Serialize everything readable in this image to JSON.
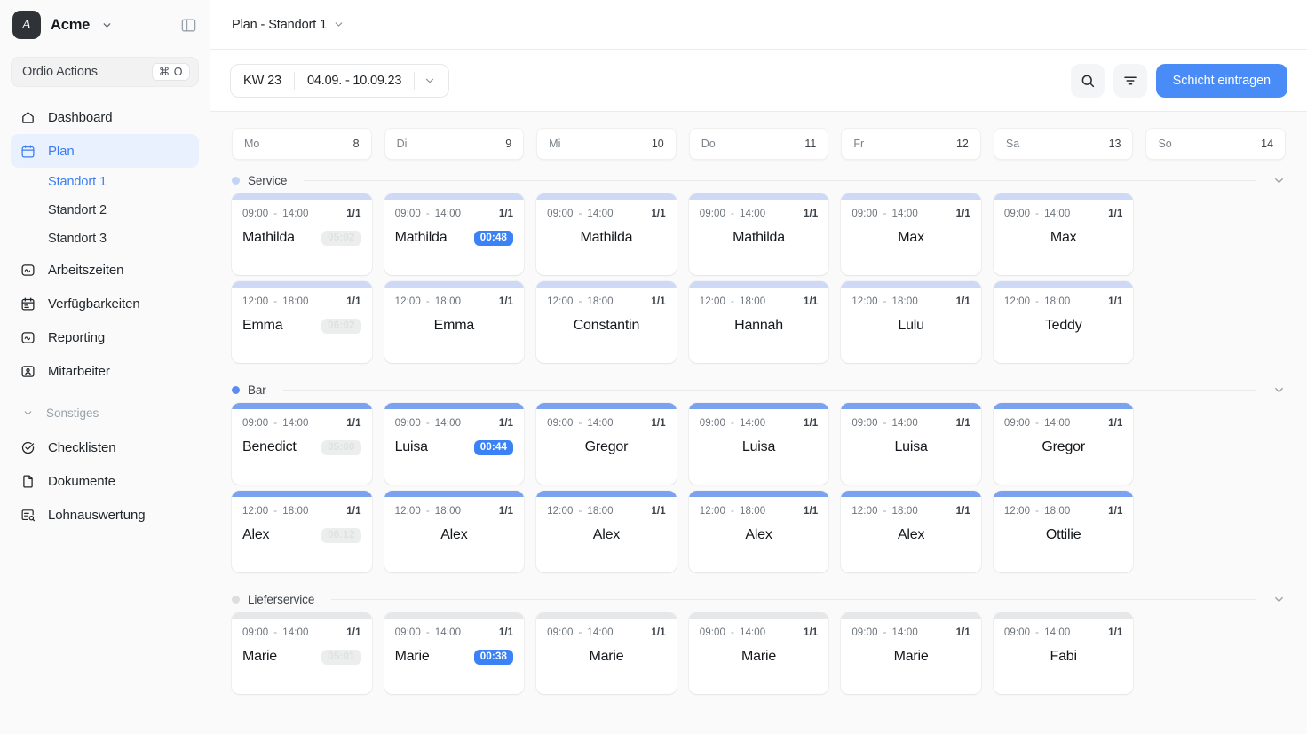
{
  "sidebar": {
    "brand": {
      "logo_letter": "A",
      "name": "Acme",
      "caret_icon": "chevron-down-icon",
      "panel_toggle_icon": "panel-toggle-icon"
    },
    "actions": {
      "label": "Ordio Actions",
      "shortcut": "⌘ O"
    },
    "items": [
      {
        "label": "Dashboard",
        "icon": "home-icon",
        "active": false
      },
      {
        "label": "Plan",
        "icon": "calendar-icon",
        "active": true
      },
      {
        "label": "Arbeitszeiten",
        "icon": "clock-wave-icon",
        "active": false
      },
      {
        "label": "Verfügbarkeiten",
        "icon": "calendar-check-icon",
        "active": false
      },
      {
        "label": "Reporting",
        "icon": "chart-wave-icon",
        "active": false
      },
      {
        "label": "Mitarbeiter",
        "icon": "user-card-icon",
        "active": false
      }
    ],
    "sub_items": [
      {
        "label": "Standort 1",
        "active": true
      },
      {
        "label": "Standort 2",
        "active": false
      },
      {
        "label": "Standort 3",
        "active": false
      }
    ],
    "group": {
      "label": "Sonstiges",
      "icon": "chevron-down-icon"
    },
    "group_items": [
      {
        "label": "Checklisten",
        "icon": "check-circle-icon"
      },
      {
        "label": "Dokumente",
        "icon": "document-icon"
      },
      {
        "label": "Lohnauswertung",
        "icon": "payroll-search-icon"
      }
    ]
  },
  "topbar": {
    "title": "Plan - Standort 1",
    "caret_icon": "chevron-down-icon"
  },
  "toolbar": {
    "week_label": "KW 23",
    "date_range": "04.09. - 10.09.23",
    "caret_icon": "chevron-down-icon",
    "search_icon": "search-icon",
    "filter_icon": "filter-icon",
    "primary_button": "Schicht eintragen"
  },
  "colors": {
    "accent": "#4a8cf7",
    "badge_blue": "#3b82f6",
    "service_bar": "#cdd9f7",
    "service_dot": "#c3d2f5",
    "bar_bar": "#7ba2f0",
    "bar_dot": "#5b8def",
    "lieferservice_bar": "#e6e7e9",
    "lieferservice_dot": "#dcdee0",
    "sidebar_bg": "#fafafa",
    "calendar_bg": "#fafafa"
  },
  "calendar": {
    "days": [
      {
        "name": "Mo",
        "num": "8"
      },
      {
        "name": "Di",
        "num": "9"
      },
      {
        "name": "Mi",
        "num": "10"
      },
      {
        "name": "Do",
        "num": "11"
      },
      {
        "name": "Fr",
        "num": "12"
      },
      {
        "name": "Sa",
        "num": "13"
      },
      {
        "name": "So",
        "num": "14"
      }
    ],
    "sections": [
      {
        "name": "Service",
        "dot_color": "#c3d2f5",
        "bar_color": "#cdd9f7",
        "caret_icon": "chevron-down-icon",
        "rows": [
          [
            {
              "start": "09:00",
              "end": "14:00",
              "count": "1/1",
              "name": "Mathilda",
              "badge": "05:02",
              "badge_style": "muted",
              "align": "left"
            },
            {
              "start": "09:00",
              "end": "14:00",
              "count": "1/1",
              "name": "Mathilda",
              "badge": "00:48",
              "badge_style": "blue",
              "align": "left"
            },
            {
              "start": "09:00",
              "end": "14:00",
              "count": "1/1",
              "name": "Mathilda",
              "badge": "",
              "badge_style": "",
              "align": "center"
            },
            {
              "start": "09:00",
              "end": "14:00",
              "count": "1/1",
              "name": "Mathilda",
              "badge": "",
              "badge_style": "",
              "align": "center"
            },
            {
              "start": "09:00",
              "end": "14:00",
              "count": "1/1",
              "name": "Max",
              "badge": "",
              "badge_style": "",
              "align": "center"
            },
            {
              "start": "09:00",
              "end": "14:00",
              "count": "1/1",
              "name": "Max",
              "badge": "",
              "badge_style": "",
              "align": "center"
            },
            null
          ],
          [
            {
              "start": "12:00",
              "end": "18:00",
              "count": "1/1",
              "name": "Emma",
              "badge": "06:02",
              "badge_style": "muted",
              "align": "left"
            },
            {
              "start": "12:00",
              "end": "18:00",
              "count": "1/1",
              "name": "Emma",
              "badge": "",
              "badge_style": "",
              "align": "center"
            },
            {
              "start": "12:00",
              "end": "18:00",
              "count": "1/1",
              "name": "Constantin",
              "badge": "",
              "badge_style": "",
              "align": "center"
            },
            {
              "start": "12:00",
              "end": "18:00",
              "count": "1/1",
              "name": "Hannah",
              "badge": "",
              "badge_style": "",
              "align": "center"
            },
            {
              "start": "12:00",
              "end": "18:00",
              "count": "1/1",
              "name": "Lulu",
              "badge": "",
              "badge_style": "",
              "align": "center"
            },
            {
              "start": "12:00",
              "end": "18:00",
              "count": "1/1",
              "name": "Teddy",
              "badge": "",
              "badge_style": "",
              "align": "center"
            },
            null
          ]
        ]
      },
      {
        "name": "Bar",
        "dot_color": "#5b8def",
        "bar_color": "#7ba2f0",
        "caret_icon": "chevron-down-icon",
        "rows": [
          [
            {
              "start": "09:00",
              "end": "14:00",
              "count": "1/1",
              "name": "Benedict",
              "badge": "05:00",
              "badge_style": "muted",
              "align": "left"
            },
            {
              "start": "09:00",
              "end": "14:00",
              "count": "1/1",
              "name": "Luisa",
              "badge": "00:44",
              "badge_style": "blue",
              "align": "left"
            },
            {
              "start": "09:00",
              "end": "14:00",
              "count": "1/1",
              "name": "Gregor",
              "badge": "",
              "badge_style": "",
              "align": "center"
            },
            {
              "start": "09:00",
              "end": "14:00",
              "count": "1/1",
              "name": "Luisa",
              "badge": "",
              "badge_style": "",
              "align": "center"
            },
            {
              "start": "09:00",
              "end": "14:00",
              "count": "1/1",
              "name": "Luisa",
              "badge": "",
              "badge_style": "",
              "align": "center"
            },
            {
              "start": "09:00",
              "end": "14:00",
              "count": "1/1",
              "name": "Gregor",
              "badge": "",
              "badge_style": "",
              "align": "center"
            },
            null
          ],
          [
            {
              "start": "12:00",
              "end": "18:00",
              "count": "1/1",
              "name": "Alex",
              "badge": "06:12",
              "badge_style": "muted",
              "align": "left"
            },
            {
              "start": "12:00",
              "end": "18:00",
              "count": "1/1",
              "name": "Alex",
              "badge": "",
              "badge_style": "",
              "align": "center"
            },
            {
              "start": "12:00",
              "end": "18:00",
              "count": "1/1",
              "name": "Alex",
              "badge": "",
              "badge_style": "",
              "align": "center"
            },
            {
              "start": "12:00",
              "end": "18:00",
              "count": "1/1",
              "name": "Alex",
              "badge": "",
              "badge_style": "",
              "align": "center"
            },
            {
              "start": "12:00",
              "end": "18:00",
              "count": "1/1",
              "name": "Alex",
              "badge": "",
              "badge_style": "",
              "align": "center"
            },
            {
              "start": "12:00",
              "end": "18:00",
              "count": "1/1",
              "name": "Ottilie",
              "badge": "",
              "badge_style": "",
              "align": "center"
            },
            null
          ]
        ]
      },
      {
        "name": "Lieferservice",
        "dot_color": "#dcdee0",
        "bar_color": "#e6e7e9",
        "caret_icon": "chevron-down-icon",
        "rows": [
          [
            {
              "start": "09:00",
              "end": "14:00",
              "count": "1/1",
              "name": "Marie",
              "badge": "05:01",
              "badge_style": "muted",
              "align": "left"
            },
            {
              "start": "09:00",
              "end": "14:00",
              "count": "1/1",
              "name": "Marie",
              "badge": "00:38",
              "badge_style": "blue",
              "align": "left"
            },
            {
              "start": "09:00",
              "end": "14:00",
              "count": "1/1",
              "name": "Marie",
              "badge": "",
              "badge_style": "",
              "align": "center"
            },
            {
              "start": "09:00",
              "end": "14:00",
              "count": "1/1",
              "name": "Marie",
              "badge": "",
              "badge_style": "",
              "align": "center"
            },
            {
              "start": "09:00",
              "end": "14:00",
              "count": "1/1",
              "name": "Marie",
              "badge": "",
              "badge_style": "",
              "align": "center"
            },
            {
              "start": "09:00",
              "end": "14:00",
              "count": "1/1",
              "name": "Fabi",
              "badge": "",
              "badge_style": "",
              "align": "center"
            },
            null
          ]
        ]
      }
    ]
  }
}
